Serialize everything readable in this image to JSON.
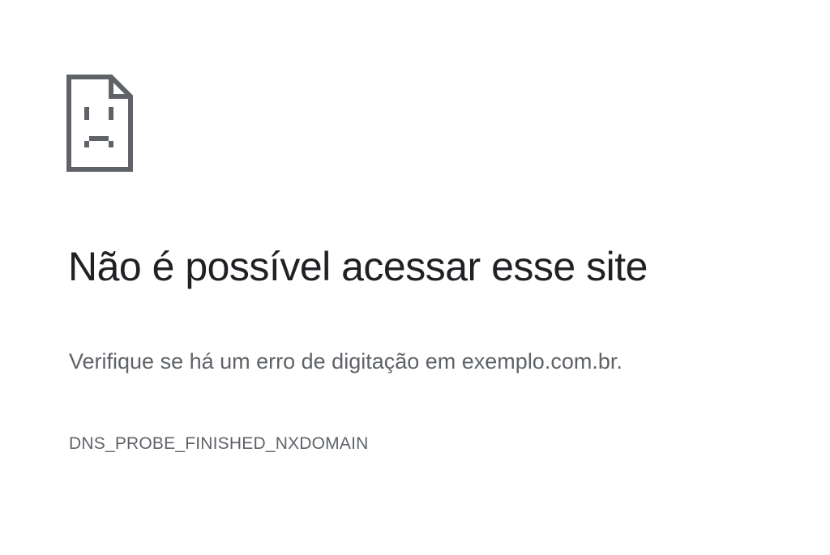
{
  "error": {
    "icon": "sad-page-icon",
    "title": "Não é possível acessar esse site",
    "description": "Verifique se há um erro de digitação em exemplo.com.br.",
    "code": "DNS_PROBE_FINISHED_NXDOMAIN"
  },
  "colors": {
    "background": "#ffffff",
    "title": "#202124",
    "secondary_text": "#5f6368",
    "icon": "#5f6368"
  }
}
